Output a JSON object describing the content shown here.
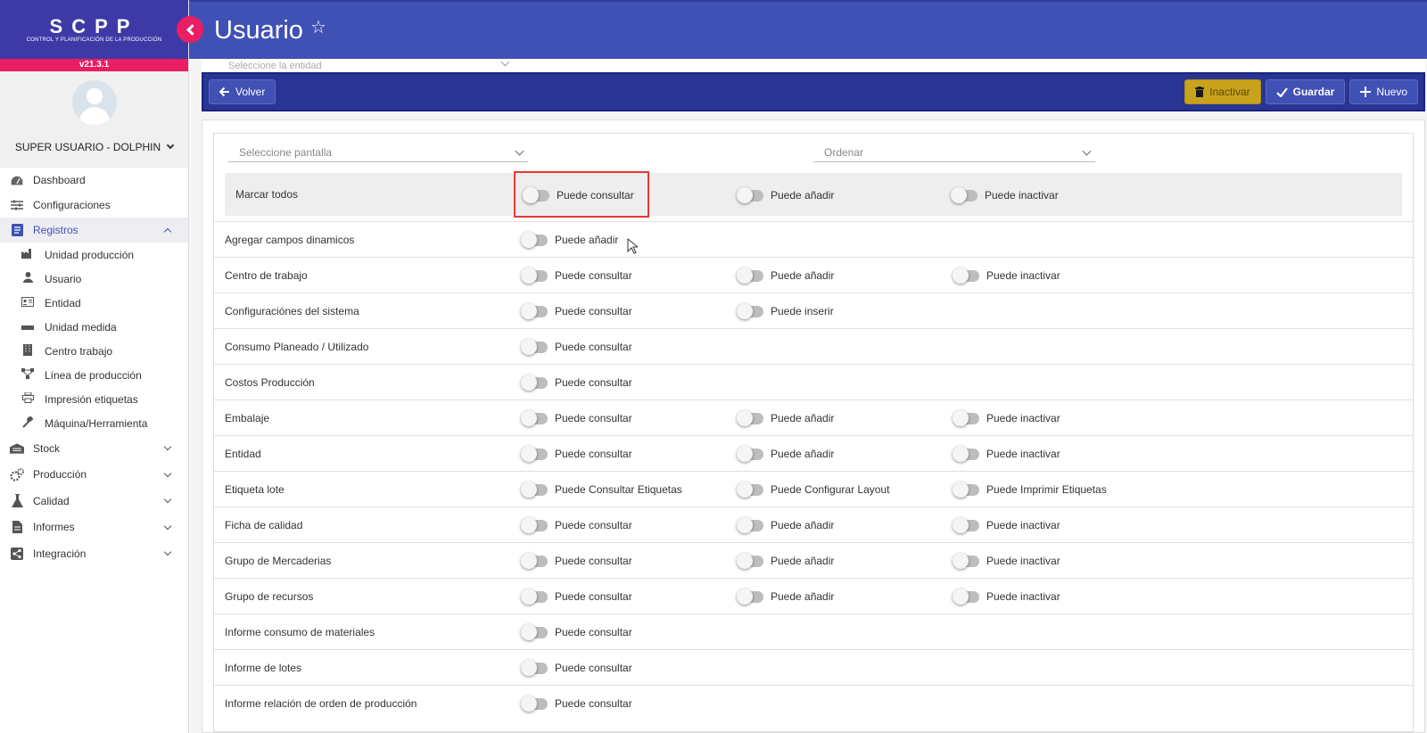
{
  "app": {
    "logo": "SCPP",
    "logo_sub": "CONTROL Y PLANIFICACIÓN DE LA PRODUCCIÓN",
    "version": "v21.3.1",
    "user_name": "SUPER USUARIO - DOLPHIN"
  },
  "nav": {
    "dashboard": "Dashboard",
    "configuraciones": "Configuraciones",
    "registros": "Registros",
    "sub": {
      "unidad_produccion": "Unidad producción",
      "usuario": "Usuario",
      "entidad": "Entidad",
      "unidad_medida": "Unidad medida",
      "centro_trabajo": "Centro trabajo",
      "linea_produccion": "Línea de producción",
      "impresion_etiquetas": "Impresión etiquetas",
      "maquina_herramienta": "Máquina/Herramienta"
    },
    "stock": "Stock",
    "produccion": "Producción",
    "calidad": "Calidad",
    "informes": "Informes",
    "integracion": "Integración"
  },
  "header": {
    "title": "Usuario",
    "star": "☆"
  },
  "entity_select_placeholder": "Seleccione la entidad",
  "actions": {
    "volver": "Volver",
    "inactivar": "Inactivar",
    "guardar": "Guardar",
    "nuevo": "Nuevo"
  },
  "filters": {
    "pantalla_placeholder": "Seleccione pantalla",
    "ordenar_placeholder": "Ordenar"
  },
  "mark_all": {
    "label": "Marcar todos",
    "p1": "Puede consultar",
    "p2": "Puede añadir",
    "p3": "Puede inactivar"
  },
  "rows": [
    {
      "name": "Agregar campos dinamicos",
      "p1": "Puede añadir",
      "p2": "",
      "p3": ""
    },
    {
      "name": "Centro de trabajo",
      "p1": "Puede consultar",
      "p2": "Puede añadir",
      "p3": "Puede inactivar"
    },
    {
      "name": "Configuraciónes del sistema",
      "p1": "Puede consultar",
      "p2": "Puede inserir",
      "p3": ""
    },
    {
      "name": "Consumo Planeado / Utilizado",
      "p1": "Puede consultar",
      "p2": "",
      "p3": ""
    },
    {
      "name": "Costos Producción",
      "p1": "Puede consultar",
      "p2": "",
      "p3": ""
    },
    {
      "name": "Embalaje",
      "p1": "Puede consultar",
      "p2": "Puede añadir",
      "p3": "Puede inactivar"
    },
    {
      "name": "Entidad",
      "p1": "Puede consultar",
      "p2": "Puede añadir",
      "p3": "Puede inactivar"
    },
    {
      "name": "Etiqueta lote",
      "p1": "Puede Consultar Etiquetas",
      "p2": "Puede Configurar Layout",
      "p3": "Puede Imprimir Etiquetas"
    },
    {
      "name": "Ficha de calidad",
      "p1": "Puede consultar",
      "p2": "Puede añadir",
      "p3": "Puede inactivar"
    },
    {
      "name": "Grupo de Mercaderias",
      "p1": "Puede consultar",
      "p2": "Puede añadir",
      "p3": "Puede inactivar"
    },
    {
      "name": "Grupo de recursos",
      "p1": "Puede consultar",
      "p2": "Puede añadir",
      "p3": "Puede inactivar"
    },
    {
      "name": "Informe consumo de materiales",
      "p1": "Puede consultar",
      "p2": "",
      "p3": ""
    },
    {
      "name": "Informe de lotes",
      "p1": "Puede consultar",
      "p2": "",
      "p3": ""
    },
    {
      "name": "Informe relación de orden de producción",
      "p1": "Puede consultar",
      "p2": "",
      "p3": ""
    }
  ],
  "colors": {
    "primary": "#3f51b5",
    "header_dark": "#283593",
    "accent": "#e91e63",
    "warning": "#c8a21a",
    "highlight": "#e53935"
  },
  "icons": {
    "back": "chevron-left-icon",
    "star": "star-outline-icon",
    "volver": "arrow-left-icon",
    "inactivar": "trash-icon",
    "guardar": "check-icon",
    "nuevo": "plus-icon"
  }
}
